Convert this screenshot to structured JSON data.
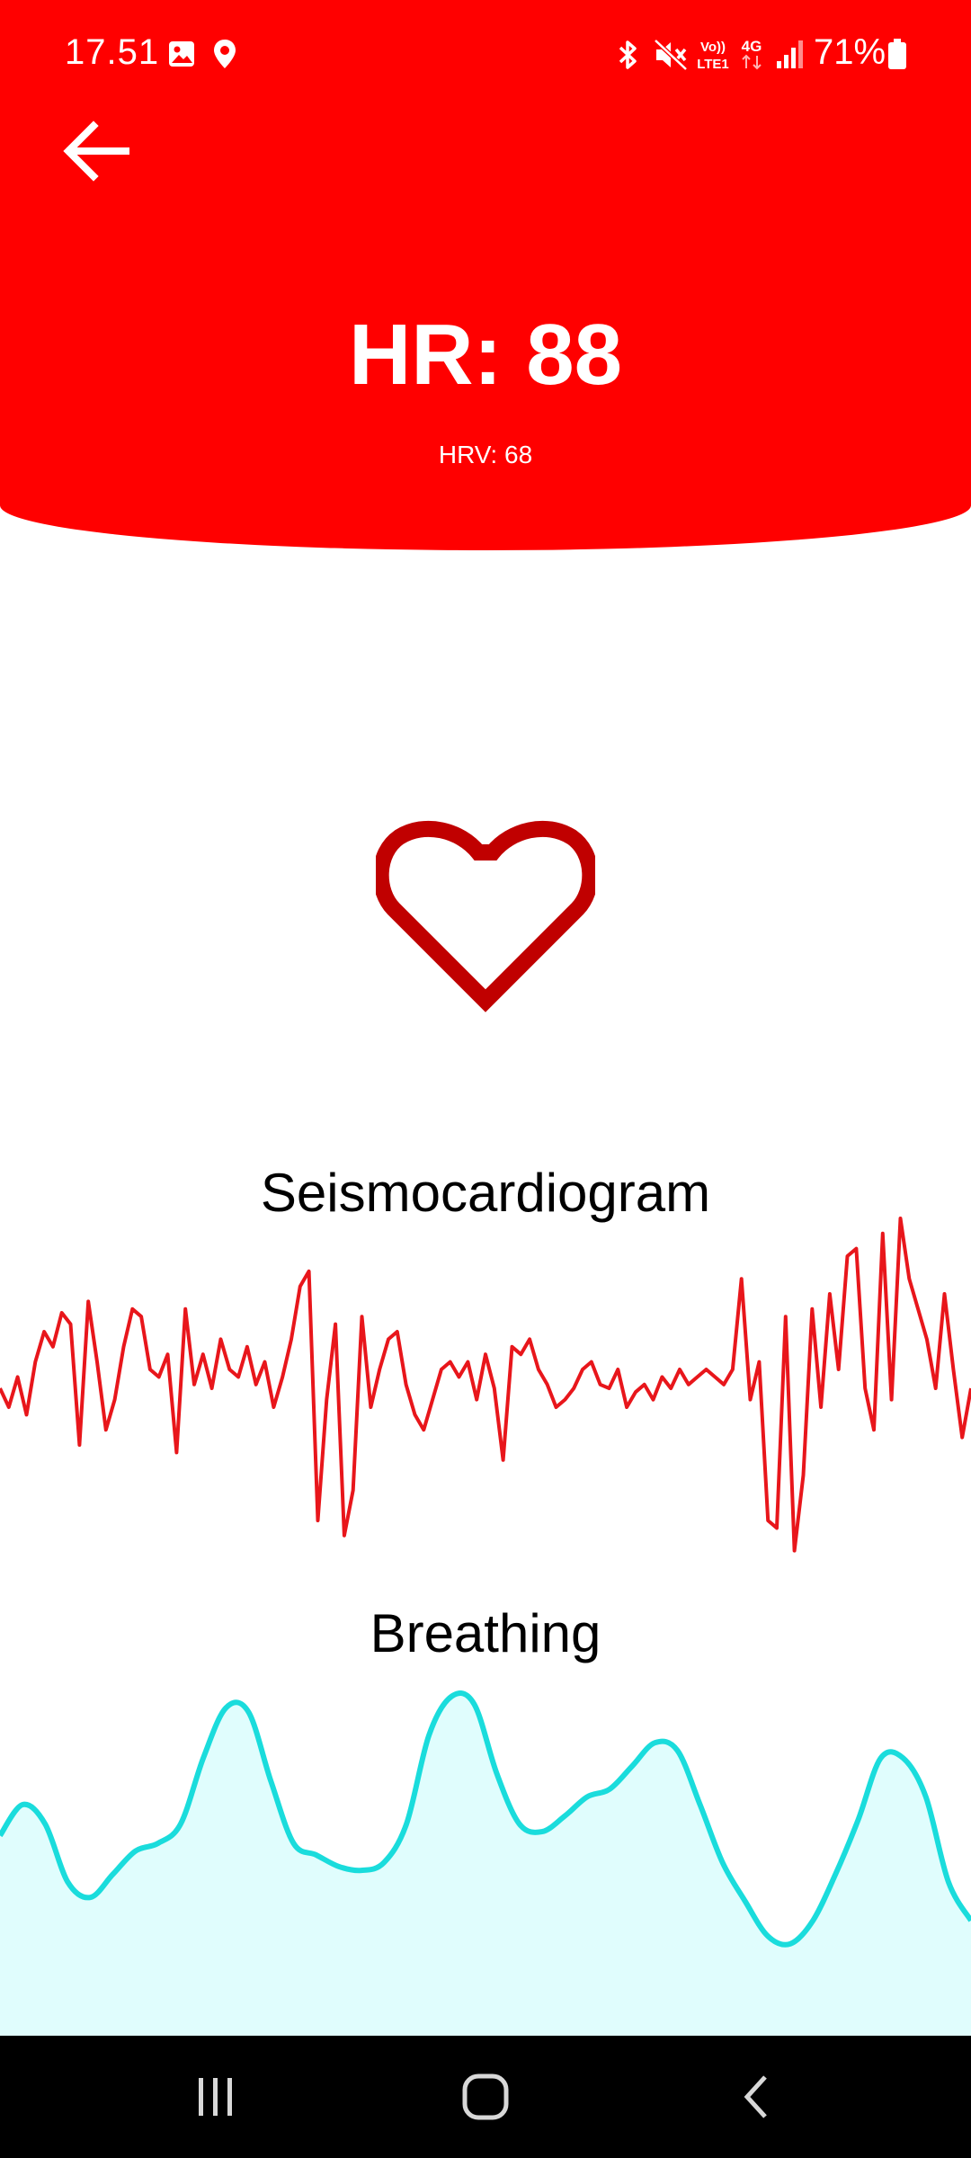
{
  "status_bar": {
    "time": "17.51",
    "battery": "71%",
    "icons": [
      "gallery-icon",
      "location-icon",
      "bluetooth-icon",
      "mute-icon",
      "volte-icon",
      "4g-icon",
      "signal-icon",
      "battery-icon"
    ]
  },
  "header": {
    "hr_text": "HR: 88",
    "hrv_text": "HRV: 68",
    "background_color": "#ff0000"
  },
  "heart_color": "#c00000",
  "seismocardiogram": {
    "label": "Seismocardiogram",
    "color": "#e8161b",
    "values": [
      0.55,
      0.5,
      0.58,
      0.48,
      0.62,
      0.7,
      0.66,
      0.75,
      0.72,
      0.4,
      0.78,
      0.62,
      0.44,
      0.52,
      0.66,
      0.76,
      0.74,
      0.6,
      0.58,
      0.64,
      0.38,
      0.76,
      0.56,
      0.64,
      0.55,
      0.68,
      0.6,
      0.58,
      0.66,
      0.56,
      0.62,
      0.5,
      0.58,
      0.68,
      0.82,
      0.86,
      0.2,
      0.52,
      0.72,
      0.16,
      0.28,
      0.74,
      0.5,
      0.6,
      0.68,
      0.7,
      0.56,
      0.48,
      0.44,
      0.52,
      0.6,
      0.62,
      0.58,
      0.62,
      0.52,
      0.64,
      0.55,
      0.36,
      0.66,
      0.64,
      0.68,
      0.6,
      0.56,
      0.5,
      0.52,
      0.55,
      0.6,
      0.62,
      0.56,
      0.55,
      0.6,
      0.5,
      0.54,
      0.56,
      0.52,
      0.58,
      0.55,
      0.6,
      0.56,
      0.58,
      0.6,
      0.58,
      0.56,
      0.6,
      0.84,
      0.52,
      0.62,
      0.2,
      0.18,
      0.74,
      0.12,
      0.32,
      0.76,
      0.5,
      0.8,
      0.6,
      0.9,
      0.92,
      0.55,
      0.44,
      0.96,
      0.52,
      1.0,
      0.84,
      0.76,
      0.68,
      0.55,
      0.8,
      0.6,
      0.42,
      0.55
    ]
  },
  "breathing": {
    "label": "Breathing",
    "line_color": "#1adcdc",
    "fill_color": "#e0fdfd",
    "values": [
      0.52,
      0.6,
      0.55,
      0.4,
      0.36,
      0.42,
      0.48,
      0.5,
      0.55,
      0.72,
      0.85,
      0.84,
      0.66,
      0.5,
      0.47,
      0.44,
      0.43,
      0.45,
      0.55,
      0.78,
      0.88,
      0.86,
      0.68,
      0.55,
      0.53,
      0.57,
      0.62,
      0.64,
      0.7,
      0.76,
      0.74,
      0.6,
      0.45,
      0.35,
      0.26,
      0.24,
      0.3,
      0.42,
      0.56,
      0.72,
      0.72,
      0.62,
      0.4,
      0.3
    ]
  },
  "nav_bar": {
    "buttons": [
      "recent-apps-icon",
      "home-icon",
      "back-icon"
    ]
  }
}
